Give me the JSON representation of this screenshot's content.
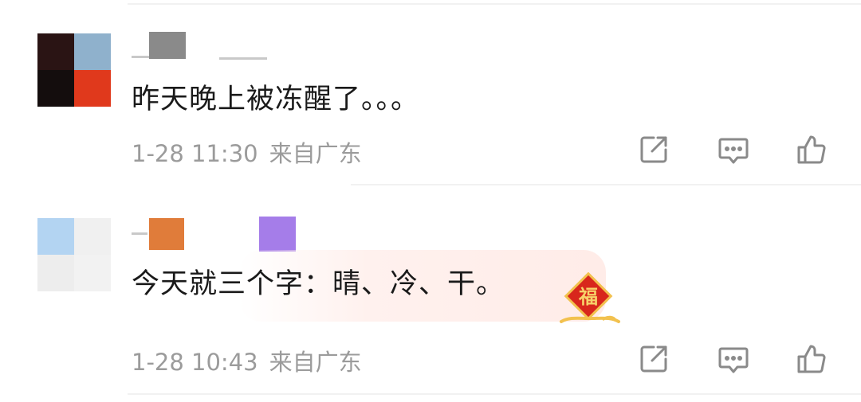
{
  "comments": [
    {
      "text": "昨天晚上被冻醒了。。。",
      "time": "1-28 11:30",
      "location": "来自广东"
    },
    {
      "text": "今天就三个字：晴、冷、干。",
      "time": "1-28 10:43",
      "location": "来自广东",
      "badge_icon": "fu-icon"
    }
  ],
  "actions": [
    "share-icon",
    "comment-icon",
    "like-icon"
  ],
  "colors": {
    "meta_text": "#9b9b9b",
    "icon": "#8a8a8a",
    "badge_red": "#d8271c",
    "badge_gold": "#f2c14e"
  }
}
